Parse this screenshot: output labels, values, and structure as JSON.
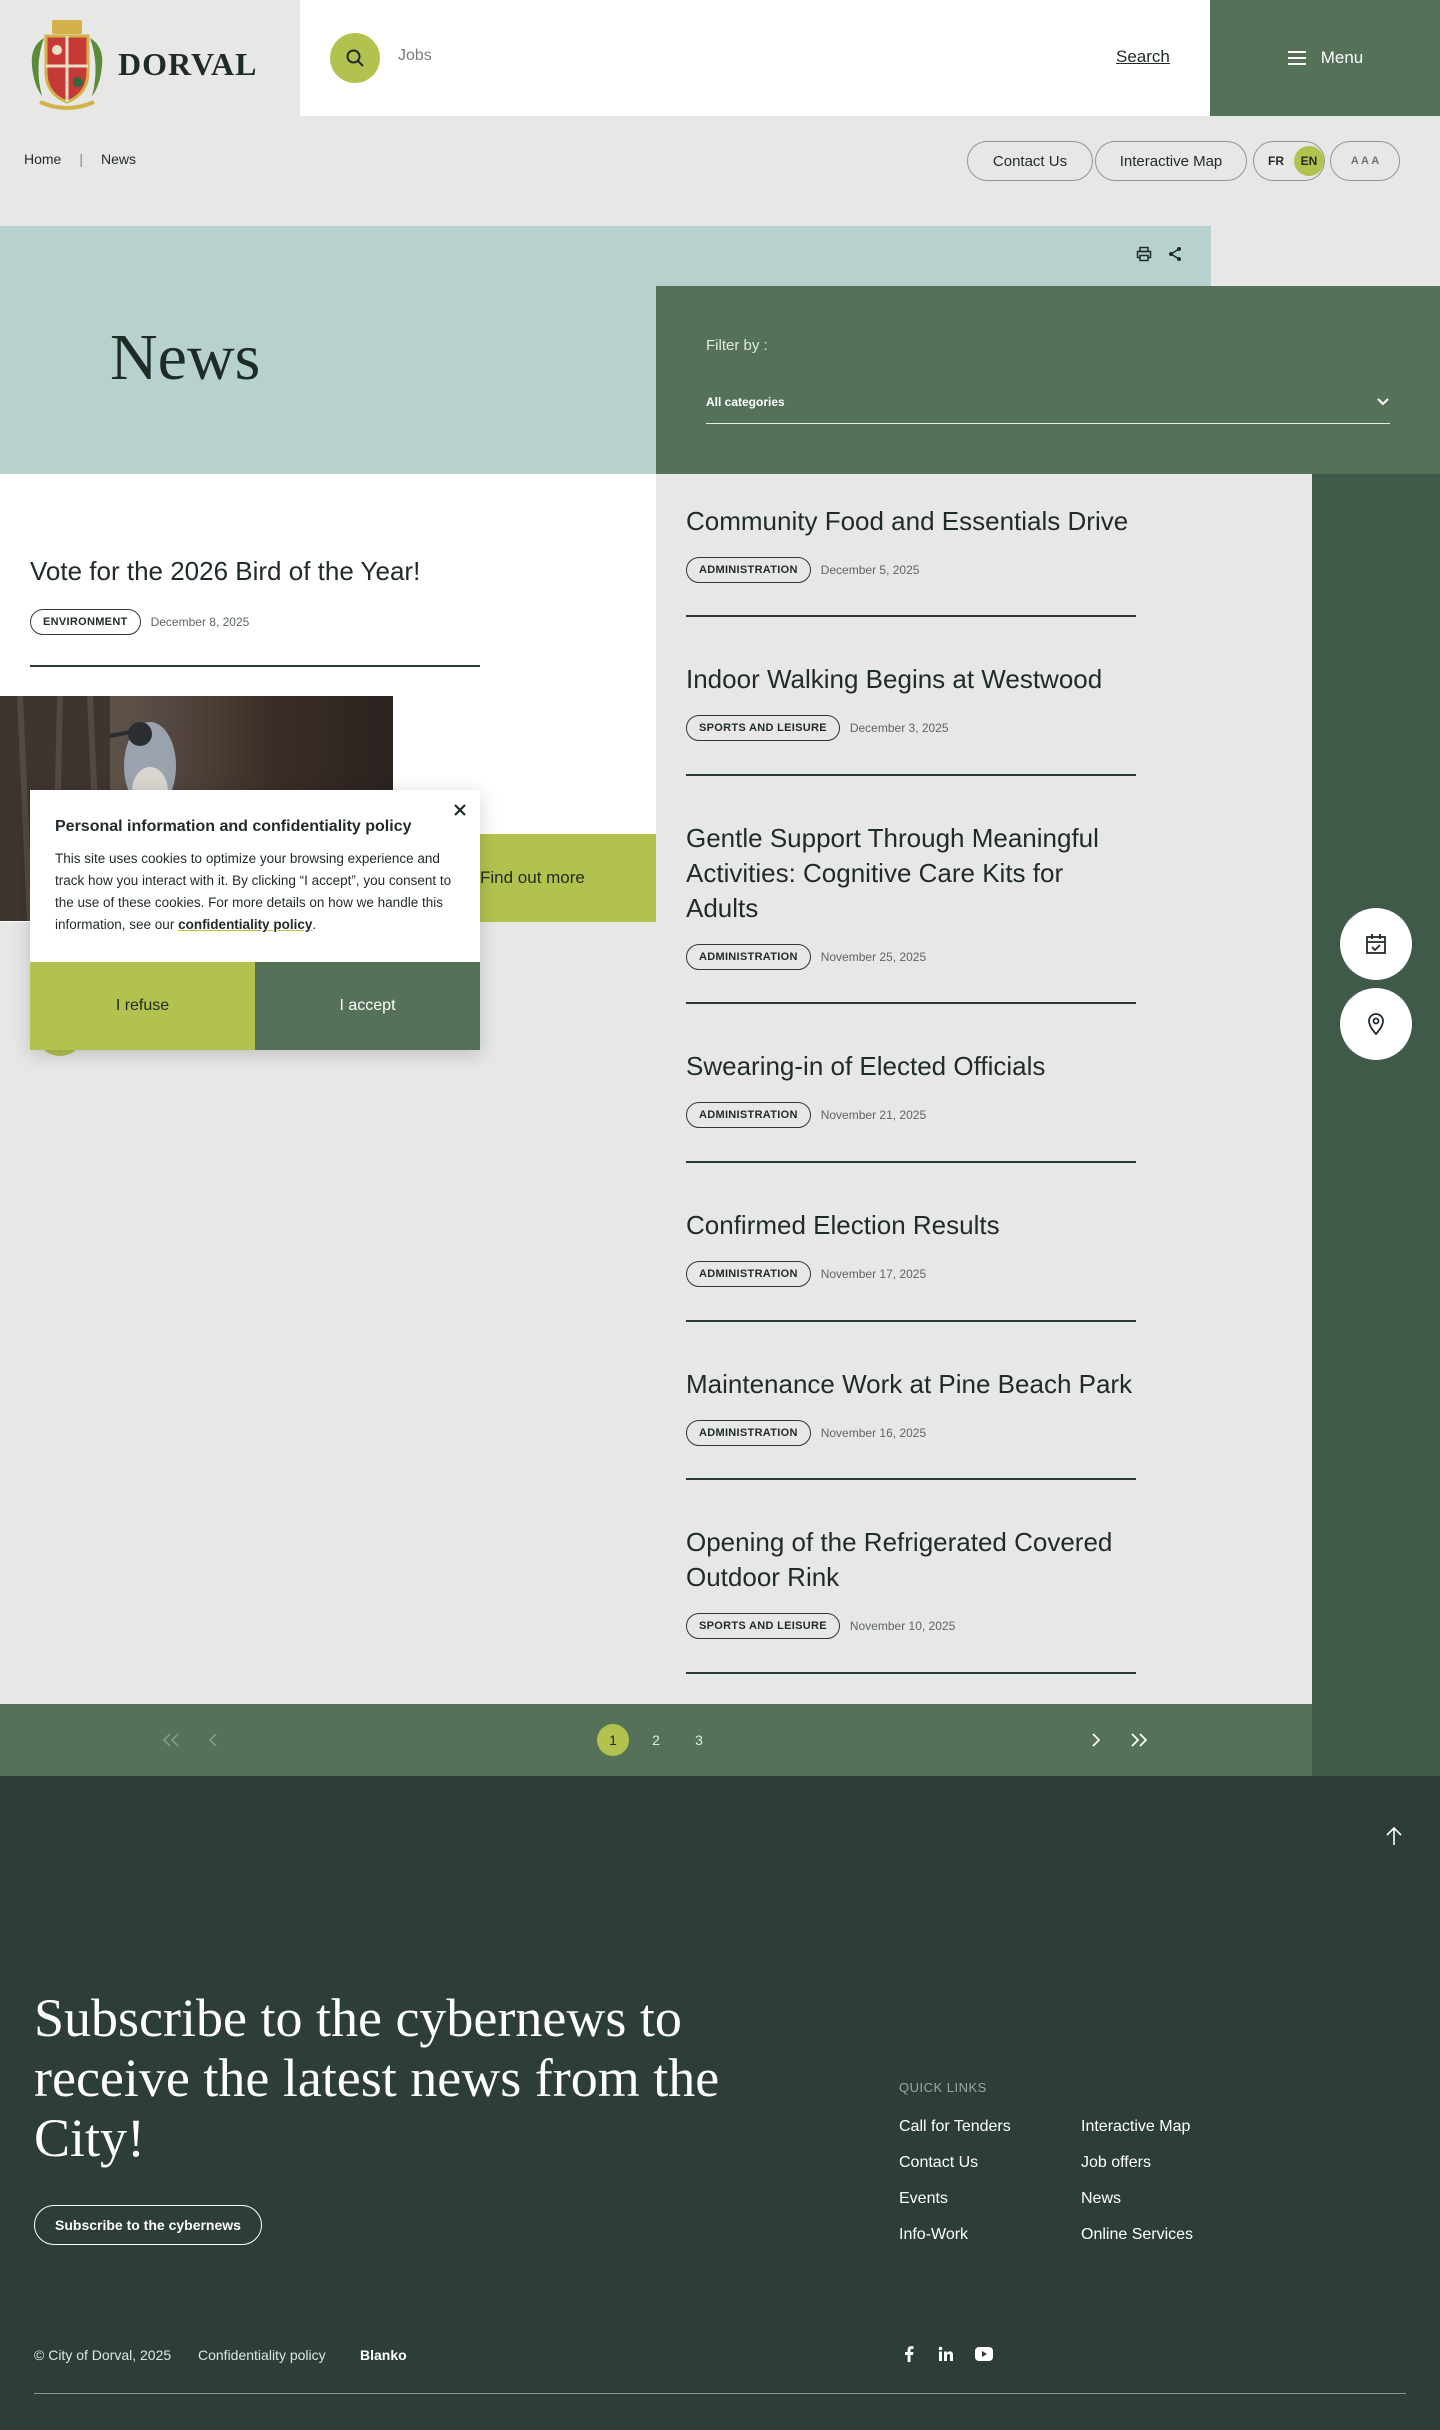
{
  "header": {
    "logo_text": "DORVAL",
    "search_placeholder": "Jobs",
    "search_label": "Search",
    "menu_label": "Menu"
  },
  "breadcrumb": [
    "Home",
    "News"
  ],
  "utility": {
    "contact_label": "Contact Us",
    "map_label": "Interactive Map",
    "lang_fr": "FR",
    "lang_en": "EN",
    "font_size_label": "A A A"
  },
  "hero": {
    "title": "News",
    "filter_label": "Filter by :",
    "filter_value": "All categories"
  },
  "featured": {
    "title": "Vote for the 2026 Bird of the Year!",
    "tag": "ENVIRONMENT",
    "date": "December 8, 2025",
    "find_more": "Find out more"
  },
  "news": [
    {
      "title": "Community Food and Essentials Drive",
      "tag": "ADMINISTRATION",
      "date": "December 5, 2025"
    },
    {
      "title": "Indoor Walking Begins at Westwood",
      "tag": "SPORTS AND LEISURE",
      "date": "December 3, 2025"
    },
    {
      "title": "Gentle Support Through Meaningful Activities: Cognitive Care Kits for Adults",
      "tag": "ADMINISTRATION",
      "date": "November 25, 2025"
    },
    {
      "title": "Swearing-in of Elected Officials",
      "tag": "ADMINISTRATION",
      "date": "November 21, 2025"
    },
    {
      "title": "Confirmed Election Results",
      "tag": "ADMINISTRATION",
      "date": "November 17, 2025"
    },
    {
      "title": "Maintenance Work at Pine Beach Park",
      "tag": "ADMINISTRATION",
      "date": "November 16, 2025"
    },
    {
      "title": "Opening of the Refrigerated Covered Outdoor Rink",
      "tag": "SPORTS AND LEISURE",
      "date": "November 10, 2025"
    }
  ],
  "pagination": {
    "pages": [
      "1",
      "2",
      "3"
    ],
    "current": "1"
  },
  "cookie": {
    "title": "Personal information and confidentiality policy",
    "body": "This site uses cookies to optimize your browsing experience and track how you interact with it. By clicking “I accept”, you consent to the use of these cookies. For more details on how we handle this information, see our ",
    "link": "confidentiality policy",
    "end": ".",
    "refuse": "I refuse",
    "accept": "I accept"
  },
  "footer": {
    "subscribe_title": "Subscribe to the cybernews to receive the latest news from the City!",
    "subscribe_button": "Subscribe to the cybernews",
    "quick_links_heading": "QUICK LINKS",
    "quick_links_col1": [
      "Call for Tenders",
      "Contact Us",
      "Events",
      "Info-Work"
    ],
    "quick_links_col2": [
      "Interactive Map",
      "Job offers",
      "News",
      "Online Services"
    ],
    "copyright": "© City of Dorval, 2025",
    "privacy": "Confidentiality policy",
    "credit": "Blanko"
  },
  "colors": {
    "accent_lime": "#b3c24e",
    "green": "#557157",
    "dark_footer": "#2d3e39",
    "mint": "#b7d2ce",
    "rail": "#3f5a49"
  },
  "icons": [
    "search-icon",
    "hamburger-icon",
    "print-icon",
    "share-icon",
    "chevron-down-icon",
    "calendar-icon",
    "map-pin-icon",
    "first-page-icon",
    "prev-page-icon",
    "next-page-icon",
    "last-page-icon",
    "arrow-up-icon",
    "facebook-icon",
    "linkedin-icon",
    "youtube-icon",
    "close-icon"
  ]
}
